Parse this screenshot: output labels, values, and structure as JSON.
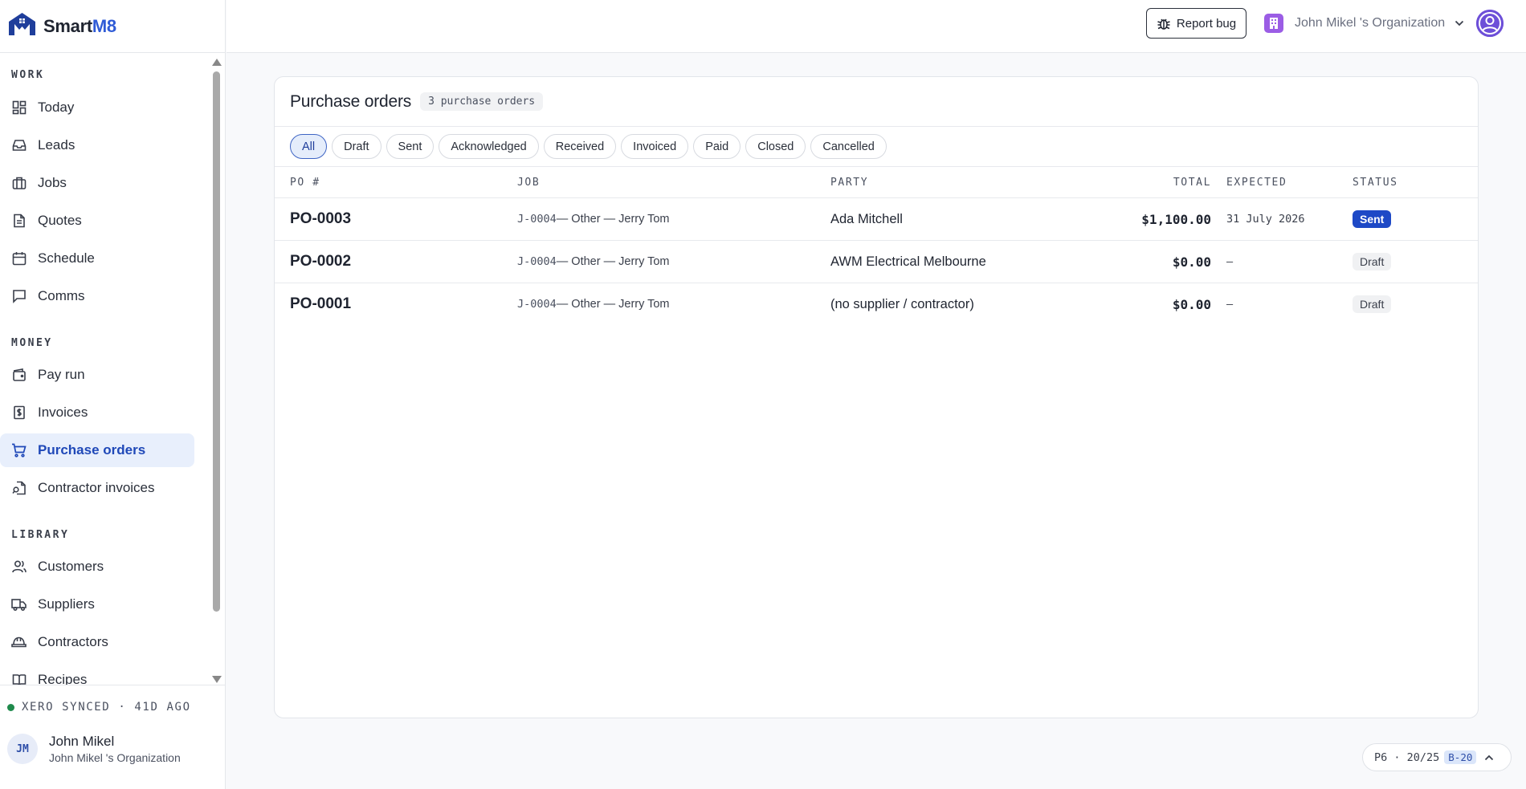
{
  "brand": {
    "name_prefix": "Smart",
    "name_suffix": "M8"
  },
  "sidebar": {
    "sections": [
      {
        "label": "WORK"
      },
      {
        "label": "MONEY"
      },
      {
        "label": "LIBRARY"
      }
    ],
    "items": [
      {
        "label": "Today",
        "icon": "dashboard-icon"
      },
      {
        "label": "Leads",
        "icon": "inbox-icon"
      },
      {
        "label": "Jobs",
        "icon": "briefcase-icon"
      },
      {
        "label": "Quotes",
        "icon": "document-icon"
      },
      {
        "label": "Schedule",
        "icon": "calendar-icon"
      },
      {
        "label": "Comms",
        "icon": "chat-icon"
      },
      {
        "label": "Pay run",
        "icon": "wallet-icon"
      },
      {
        "label": "Invoices",
        "icon": "dollar-receipt-icon"
      },
      {
        "label": "Purchase orders",
        "icon": "cart-icon",
        "active": true
      },
      {
        "label": "Contractor invoices",
        "icon": "file-search-icon"
      },
      {
        "label": "Customers",
        "icon": "users-icon"
      },
      {
        "label": "Suppliers",
        "icon": "truck-icon"
      },
      {
        "label": "Contractors",
        "icon": "hard-hat-icon"
      },
      {
        "label": "Recipes",
        "icon": "book-icon"
      }
    ],
    "sync_status": "XERO SYNCED · 41D AGO",
    "user": {
      "initials": "JM",
      "name": "John Mikel",
      "org": "John Mikel 's Organization"
    }
  },
  "header": {
    "report_bug_label": "Report bug",
    "org_name": "John Mikel 's Organization"
  },
  "main": {
    "title": "Purchase orders",
    "count_label": "3 purchase orders",
    "filters": [
      {
        "label": "All",
        "active": true
      },
      {
        "label": "Draft"
      },
      {
        "label": "Sent"
      },
      {
        "label": "Acknowledged"
      },
      {
        "label": "Received"
      },
      {
        "label": "Invoiced"
      },
      {
        "label": "Paid"
      },
      {
        "label": "Closed"
      },
      {
        "label": "Cancelled"
      }
    ],
    "columns": {
      "po": "PO #",
      "job": "JOB",
      "party": "PARTY",
      "total": "TOTAL",
      "expected": "EXPECTED",
      "status": "STATUS"
    },
    "rows": [
      {
        "po": "PO-0003",
        "job_code": "J-0004",
        "job_rest": " — Other — Jerry Tom",
        "party": "Ada Mitchell",
        "total": "$1,100.00",
        "expected": "31 July 2026",
        "status": "Sent"
      },
      {
        "po": "PO-0002",
        "job_code": "J-0004",
        "job_rest": " — Other — Jerry Tom",
        "party": "AWM Electrical Melbourne",
        "total": "$0.00",
        "expected": "–",
        "status": "Draft"
      },
      {
        "po": "PO-0001",
        "job_code": "J-0004",
        "job_rest": " — Other — Jerry Tom",
        "party": "(no supplier / contractor)",
        "total": "$0.00",
        "expected": "–",
        "status": "Draft"
      }
    ]
  },
  "floating": {
    "text": "P6 · 20/25",
    "badge": "B-20"
  },
  "colors": {
    "accent": "#1e49c6",
    "active_bg": "#e8effc",
    "sync_dot": "#1f8a4c",
    "org_badge": "#9b5de5",
    "profile": "#6d4fd8"
  }
}
